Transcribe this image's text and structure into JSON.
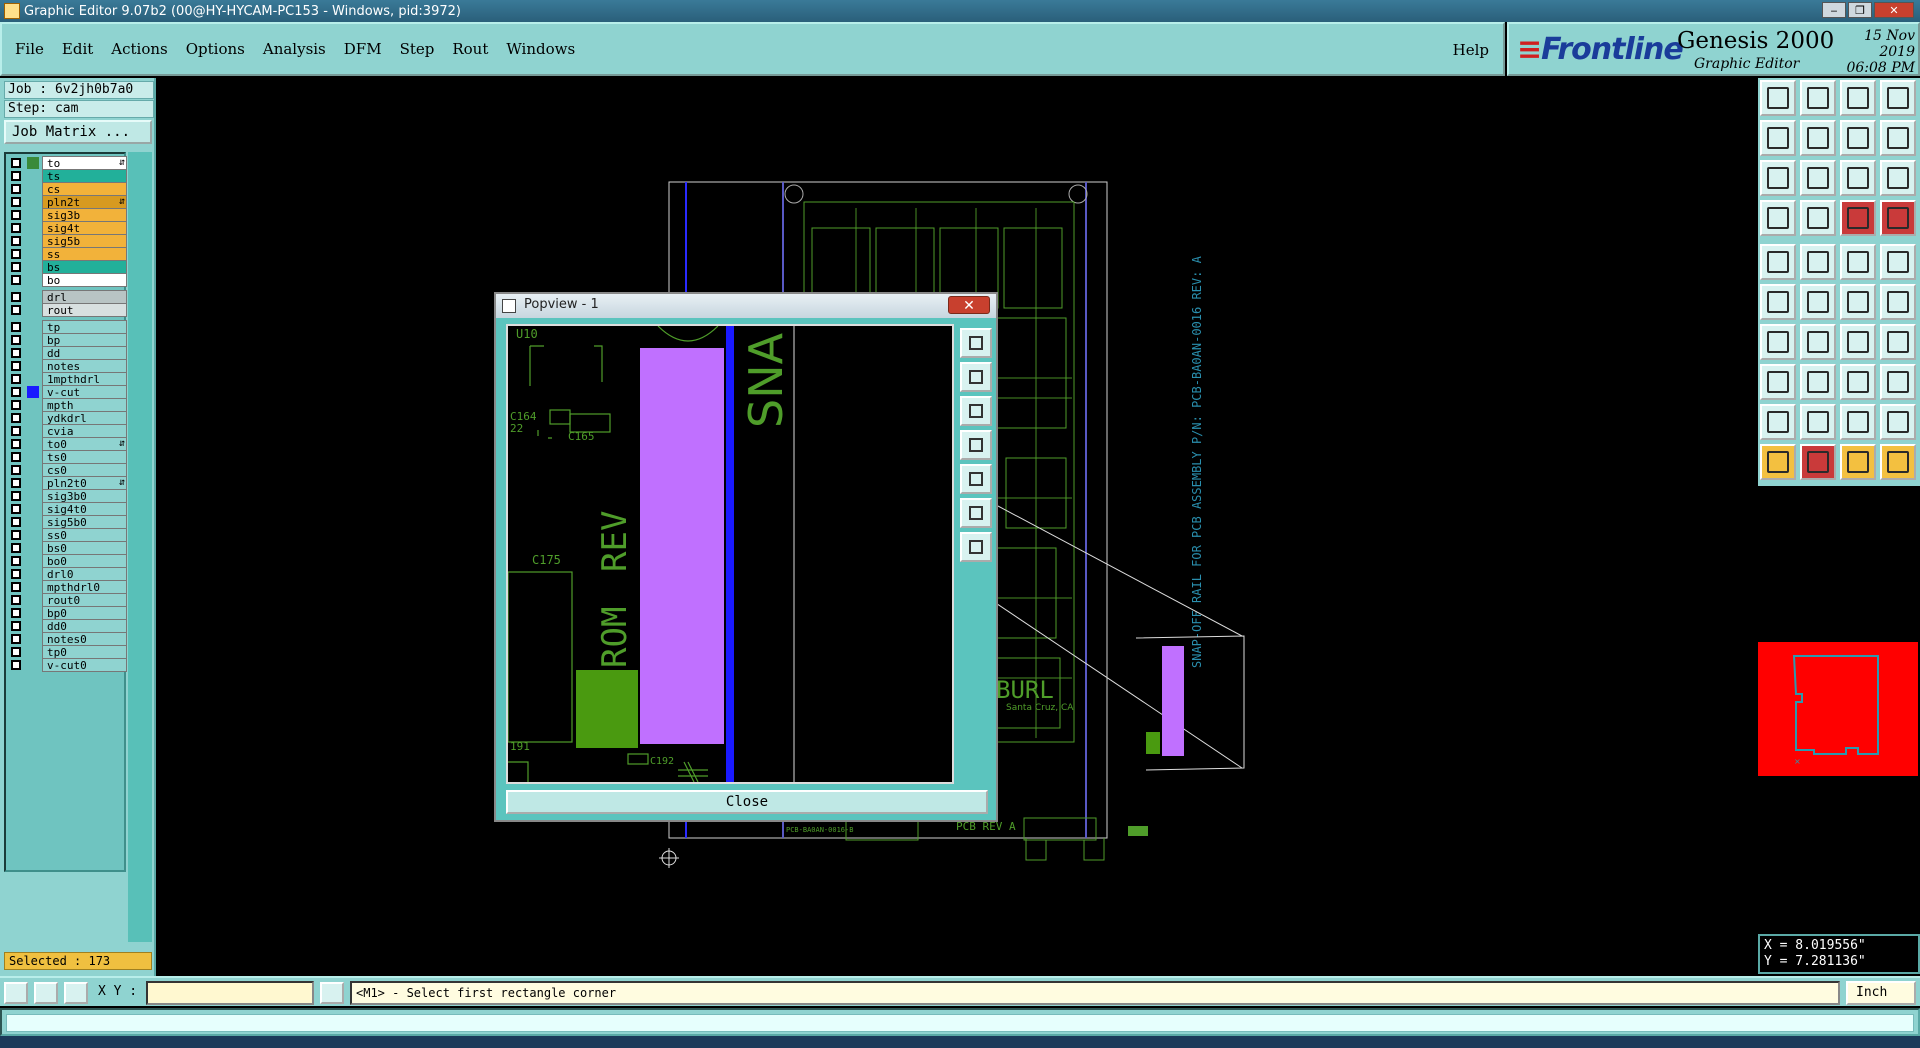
{
  "window": {
    "title": "Graphic Editor 9.07b2 (00@HY-HYCAM-PC153 - Windows, pid:3972)"
  },
  "menu": {
    "items": [
      "File",
      "Edit",
      "Actions",
      "Options",
      "Analysis",
      "DFM",
      "Step",
      "Rout",
      "Windows"
    ],
    "help": "Help"
  },
  "brand": {
    "logo": "Frontline",
    "product": "Genesis 2000",
    "subtitle": "Graphic Editor",
    "date": "15 Nov 2019",
    "time": "06:08 PM"
  },
  "job": {
    "job_label": "Job : 6v2jh0b7a0",
    "step_label": "Step: cam",
    "matrix_button": "Job Matrix ..."
  },
  "layers": [
    {
      "name": "to",
      "color": "#ffffff",
      "flag": "⇵"
    },
    {
      "name": "ts",
      "color": "#22b09a"
    },
    {
      "name": "cs",
      "color": "#f2b23a"
    },
    {
      "name": "pln2t",
      "color": "#d79a20",
      "flag": "⇵"
    },
    {
      "name": "sig3b",
      "color": "#f2b23a"
    },
    {
      "name": "sig4t",
      "color": "#f2b23a"
    },
    {
      "name": "sig5b",
      "color": "#f2b23a"
    },
    {
      "name": "ss",
      "color": "#f2b23a"
    },
    {
      "name": "bs",
      "color": "#22b09a"
    },
    {
      "name": "bo",
      "color": "#ffffff"
    },
    {
      "name": "drl",
      "color": "#b8c4c4"
    },
    {
      "name": "rout",
      "color": "#d8e0e0"
    },
    {
      "name": "tp",
      "color": "#8fd3d0"
    },
    {
      "name": "bp",
      "color": "#8fd3d0"
    },
    {
      "name": "dd",
      "color": "#8fd3d0"
    },
    {
      "name": "notes",
      "color": "#8fd3d0"
    },
    {
      "name": "1mpthdrl",
      "color": "#8fd3d0"
    },
    {
      "name": "v-cut",
      "color": "#8fd3d0"
    },
    {
      "name": "mpth",
      "color": "#8fd3d0"
    },
    {
      "name": "ydkdrl",
      "color": "#8fd3d0"
    },
    {
      "name": "cvia",
      "color": "#8fd3d0"
    },
    {
      "name": "to0",
      "color": "#8fd3d0",
      "flag": "⇵"
    },
    {
      "name": "ts0",
      "color": "#8fd3d0"
    },
    {
      "name": "cs0",
      "color": "#8fd3d0"
    },
    {
      "name": "pln2t0",
      "color": "#8fd3d0",
      "flag": "⇵"
    },
    {
      "name": "sig3b0",
      "color": "#8fd3d0"
    },
    {
      "name": "sig4t0",
      "color": "#8fd3d0"
    },
    {
      "name": "sig5b0",
      "color": "#8fd3d0"
    },
    {
      "name": "ss0",
      "color": "#8fd3d0"
    },
    {
      "name": "bs0",
      "color": "#8fd3d0"
    },
    {
      "name": "bo0",
      "color": "#8fd3d0"
    },
    {
      "name": "drl0",
      "color": "#8fd3d0"
    },
    {
      "name": "mpthdrl0",
      "color": "#8fd3d0"
    },
    {
      "name": "rout0",
      "color": "#8fd3d0"
    },
    {
      "name": "bp0",
      "color": "#8fd3d0"
    },
    {
      "name": "dd0",
      "color": "#8fd3d0"
    },
    {
      "name": "notes0",
      "color": "#8fd3d0"
    },
    {
      "name": "tp0",
      "color": "#8fd3d0"
    },
    {
      "name": "v-cut0",
      "color": "#8fd3d0"
    }
  ],
  "selected_label": "Selected : 173",
  "popview": {
    "title": "Popview - 1",
    "close_button": "Close",
    "labels": {
      "u10": "U10",
      "c164": "C164",
      "c22": "22",
      "c165": "C165",
      "c175": "C175",
      "rev": "REV",
      "rom": "ROM",
      "sna": "SNA",
      "c191": "191",
      "c192": "C192"
    }
  },
  "board": {
    "rail_text": "SNAP-OFF RAIL FOR PCB ASSEMBLY P/N: PCB-BA0AN-0016 REV: A",
    "burl": "BURL",
    "santa_cruz": "Santa Cruz, CA",
    "pcb_rev": "PCB REV A",
    "part_label": "PCB-BA0AN-0016-B"
  },
  "status": {
    "xy_label": "X Y :",
    "xy_value": "",
    "message": "<M1> - Select first rectangle corner",
    "units": "Inch"
  },
  "coords": {
    "x": "X = 8.019556\"",
    "y": "Y = 7.281136\""
  }
}
